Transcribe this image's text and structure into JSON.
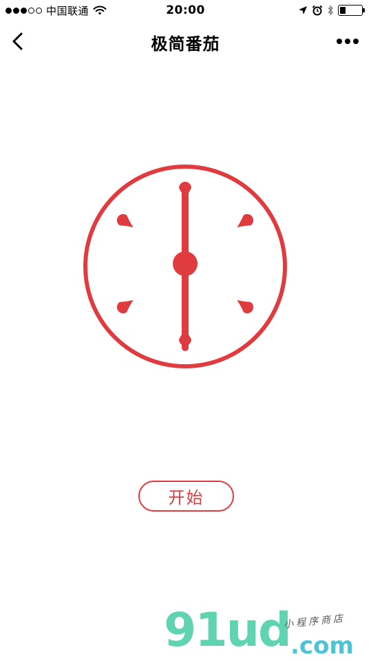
{
  "status_bar": {
    "carrier": "中国联通",
    "time": "20:00",
    "signal_filled": 3,
    "signal_total": 5,
    "battery_level": 0.25,
    "icons": [
      "wifi-icon",
      "location-arrow-icon",
      "alarm-icon",
      "bluetooth-icon",
      "battery-icon"
    ]
  },
  "nav": {
    "title": "极简番茄",
    "back_icon": "chevron-left-icon",
    "more_icon": "more-dots-icon"
  },
  "clock": {
    "color": "#e03c3f",
    "hour_marks": 6
  },
  "start_button": {
    "label": "开始"
  },
  "watermark": {
    "logo": "91ud",
    "domain": ".com",
    "subtitle": "小程序商店"
  }
}
